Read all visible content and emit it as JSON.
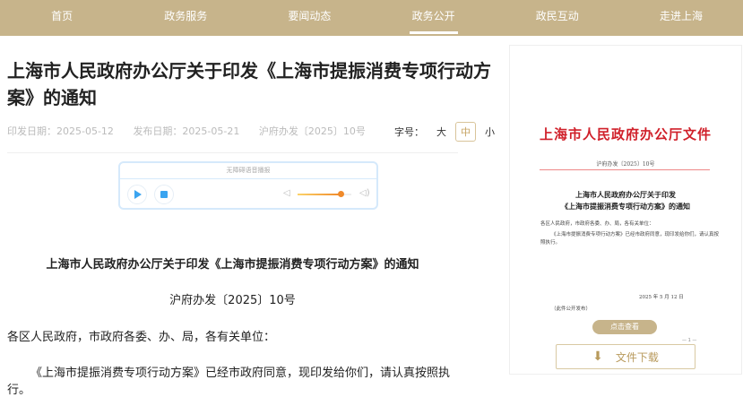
{
  "nav": {
    "items": [
      "首页",
      "政务服务",
      "要闻动态",
      "政务公开",
      "政民互动",
      "走进上海"
    ],
    "active": 3
  },
  "article": {
    "title": "上海市人民政府办公厅关于印发《上海市提振消费专项行动方案》的通知",
    "print_date": "印发日期：2025-05-12",
    "publish_date": "发布日期：2025-05-21",
    "doc_no": "沪府办发〔2025〕10号",
    "font_size_label": "字号：",
    "font_sizes": [
      "大",
      "中",
      "小"
    ],
    "body": [
      "上海市人民政府办公厅关于印发《上海市提振消费专项行动方案》的通知",
      "沪府办发〔2025〕10号",
      "各区人民政府，市政府各委、办、局，各有关单位：",
      "《上海市提振消费专项行动方案》已经市政府同意，现印发给你们，请认真按照执行。"
    ]
  },
  "audio": {
    "title": "无障碍语音播报",
    "volume": 0.8
  },
  "preview": {
    "header": "上海市人民政府办公厅文件",
    "doc_no": "沪府办发〔2025〕10号",
    "title_line1": "上海市人民政府办公厅关于印发",
    "title_line2": "《上海市提振消费专项行动方案》的通知",
    "p1": "各区人民政府，市政府各委、办、局，各有关单位：",
    "p2": "《上海市提振消费专项行动方案》已经市政府同意，现印发给你们，请认真按照执行。",
    "date": "2025 年 5 月 12 日",
    "note": "（此件公开发布）",
    "page": "— 1 —",
    "view_label": "点击查看",
    "download_label": "文件下载"
  }
}
